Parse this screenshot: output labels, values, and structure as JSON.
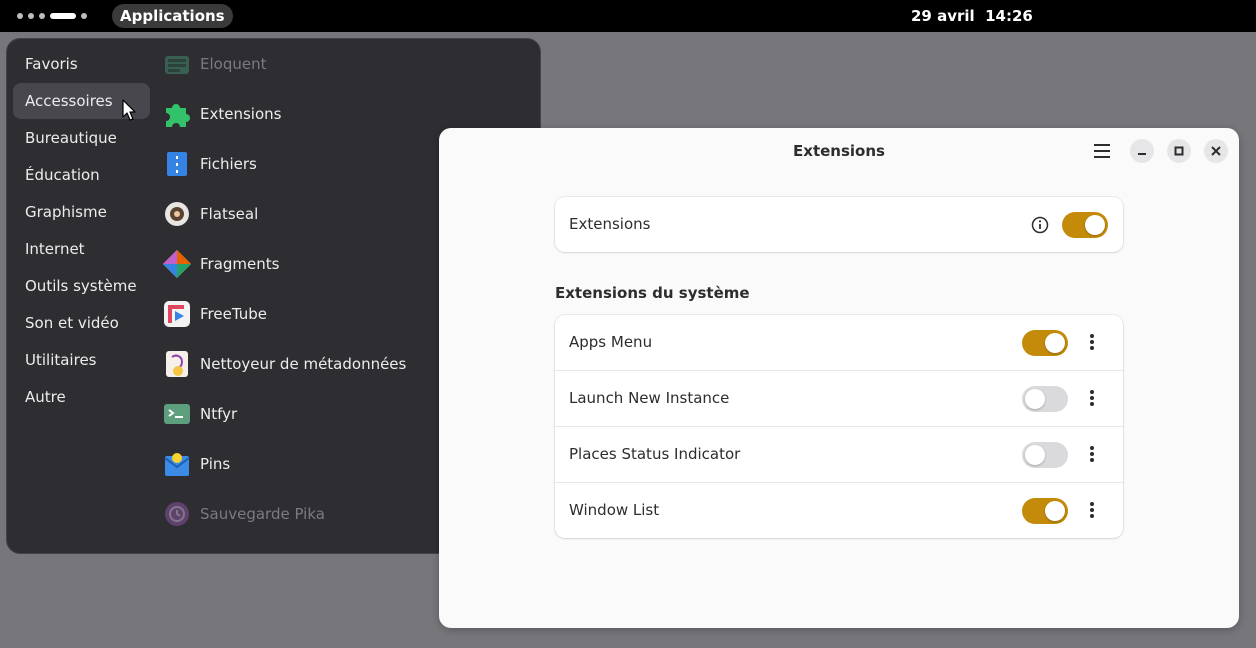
{
  "topbar": {
    "activities_label": "Applications",
    "clock": "29 avril  14:26"
  },
  "app_menu": {
    "categories": [
      {
        "label": "Favoris",
        "selected": false
      },
      {
        "label": "Accessoires",
        "selected": true
      },
      {
        "label": "Bureautique",
        "selected": false
      },
      {
        "label": "Éducation",
        "selected": false
      },
      {
        "label": "Graphisme",
        "selected": false
      },
      {
        "label": "Internet",
        "selected": false
      },
      {
        "label": "Outils système",
        "selected": false
      },
      {
        "label": "Son et vidéo",
        "selected": false
      },
      {
        "label": "Utilitaires",
        "selected": false
      },
      {
        "label": "Autre",
        "selected": false
      }
    ],
    "apps": [
      {
        "label": "Eloquent",
        "icon": "eloquent-icon",
        "dimmed": true
      },
      {
        "label": "Extensions",
        "icon": "puzzle-icon",
        "dimmed": false
      },
      {
        "label": "Fichiers",
        "icon": "files-icon",
        "dimmed": false
      },
      {
        "label": "Flatseal",
        "icon": "flatseal-icon",
        "dimmed": false
      },
      {
        "label": "Fragments",
        "icon": "fragments-icon",
        "dimmed": false
      },
      {
        "label": "FreeTube",
        "icon": "freetube-icon",
        "dimmed": false
      },
      {
        "label": "Nettoyeur de métadonnées",
        "icon": "metadata-cleaner-icon",
        "dimmed": false
      },
      {
        "label": "Ntfyr",
        "icon": "terminal-icon",
        "dimmed": false
      },
      {
        "label": "Pins",
        "icon": "pins-icon",
        "dimmed": false
      },
      {
        "label": "Sauvegarde Pika",
        "icon": "pika-backup-icon",
        "dimmed": true
      }
    ]
  },
  "window": {
    "title": "Extensions",
    "main_toggle": {
      "label": "Extensions",
      "enabled": true
    },
    "section_title": "Extensions du système",
    "extensions": [
      {
        "label": "Apps Menu",
        "enabled": true
      },
      {
        "label": "Launch New Instance",
        "enabled": false
      },
      {
        "label": "Places Status Indicator",
        "enabled": false
      },
      {
        "label": "Window List",
        "enabled": true
      }
    ]
  },
  "colors": {
    "accent": "#c48b0b",
    "menu_bg": "#2e2e32",
    "desktop_bg": "#77767b"
  }
}
